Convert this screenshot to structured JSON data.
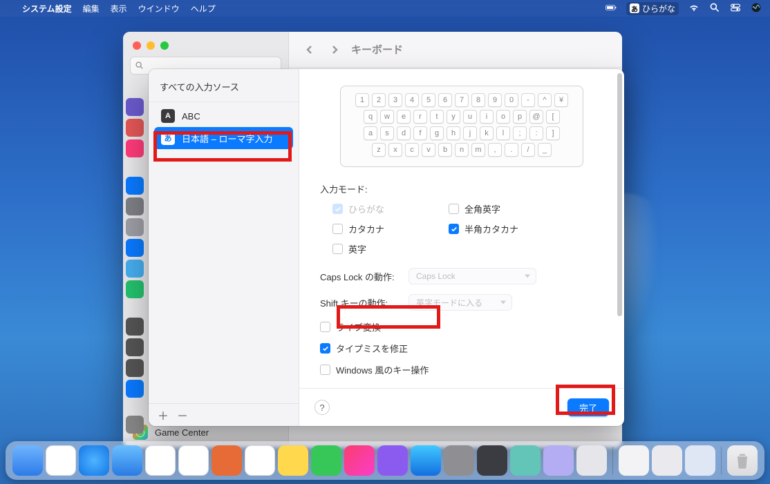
{
  "menubar": {
    "app_name": "システム設定",
    "menus": [
      "編集",
      "表示",
      "ウインドウ",
      "ヘルプ"
    ],
    "ime_label": "ひらがな"
  },
  "settings": {
    "title": "キーボード",
    "sidebar_trailing": [
      {
        "label": "Game Center"
      }
    ]
  },
  "sheet": {
    "title": "すべての入力ソース",
    "sources": [
      {
        "glyph": "A",
        "label": "ABC",
        "selected": false
      },
      {
        "glyph": "あ",
        "label": "日本語 – ローマ字入力",
        "selected": true
      }
    ],
    "keyboard_rows": [
      [
        "1",
        "2",
        "3",
        "4",
        "5",
        "6",
        "7",
        "8",
        "9",
        "0",
        "-",
        "^",
        "¥"
      ],
      [
        "q",
        "w",
        "e",
        "r",
        "t",
        "y",
        "u",
        "i",
        "o",
        "p",
        "@",
        "["
      ],
      [
        "a",
        "s",
        "d",
        "f",
        "g",
        "h",
        "j",
        "k",
        "l",
        ";",
        ":",
        "]"
      ],
      [
        "z",
        "x",
        "c",
        "v",
        "b",
        "n",
        "m",
        ",",
        ".",
        "/",
        "_"
      ]
    ],
    "input_mode_label": "入力モード:",
    "input_modes": [
      {
        "label": "ひらがな",
        "checked": true,
        "disabled": true
      },
      {
        "label": "全角英字",
        "checked": false,
        "disabled": false
      },
      {
        "label": "カタカナ",
        "checked": false,
        "disabled": false
      },
      {
        "label": "半角カタカナ",
        "checked": true,
        "disabled": false
      },
      {
        "label": "英字",
        "checked": false,
        "disabled": false
      }
    ],
    "caps_lock_label": "Caps Lock の動作:",
    "caps_lock_value": "Caps Lock",
    "shift_label": "Shift キーの動作:",
    "shift_value": "英字モードに入る",
    "toggles": [
      {
        "label": "ライブ変換",
        "checked": false
      },
      {
        "label": "タイプミスを修正",
        "checked": true
      },
      {
        "label": "Windows 風のキー操作",
        "checked": false
      }
    ],
    "done_label": "完了",
    "help_label": "?"
  }
}
